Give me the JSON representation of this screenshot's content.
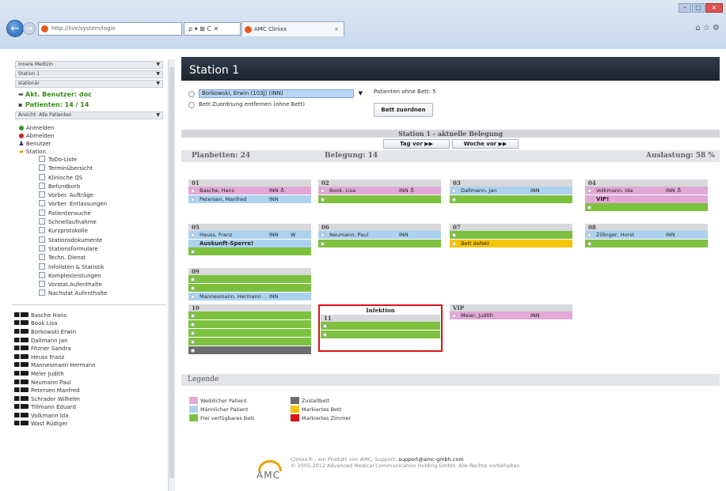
{
  "browser": {
    "url": "http://live/system/login",
    "search_controls": "ρ ▾ ⊠ C ✕",
    "tab_title": "AMC Clinixx",
    "tab_close": "×",
    "back_glyph": "←",
    "forward_glyph": "→",
    "min_glyph": "–",
    "max_glyph": "□",
    "close_glyph": "×",
    "tools_glyphs": "⌂ ☆ ⚙"
  },
  "sidebar": {
    "select_department": "Innere Medizin",
    "select_station": "Station 1",
    "select_type": "stationär",
    "current_user": "Akt. Benutzer: doc",
    "patients_count": "Patienten: 14 / 14",
    "view_select": "Ansicht: Alle Patienten",
    "menu": [
      {
        "label": "Anmelden",
        "icon": "login-icon"
      },
      {
        "label": "Abmelden",
        "icon": "logout-icon"
      },
      {
        "label": "Benutzer",
        "icon": "user-icon"
      },
      {
        "label": "Station",
        "icon": "folder-icon"
      }
    ],
    "submenu": [
      "ToDo-Liste",
      "Terminübersicht",
      "Klinische QS",
      "Befundkorb",
      "Vorber. Aufträge",
      "Vorber. Entlassungen",
      "Patientensuche",
      "Schnellaufnahme",
      "Kurzprotokolle",
      "Stationsdokumente",
      "Stationsformulare",
      "Techn. Dienst",
      "Infolisten & Statistik",
      "Komplexleistungen",
      "Vorstat.Aufenthalte",
      "Nachstat.Aufenthalte"
    ],
    "patients": [
      "Basche Hans",
      "Book Lisa",
      "Borkowski Erwin",
      "Dallmann Jan",
      "Fitzner Sandra",
      "Heuss Franz",
      "Mannesmann Hermann",
      "Meier Judith",
      "Neumann Paul",
      "Petersen Manfred",
      "Schrader Wilhelm",
      "Tillmann Eduard",
      "Volkmann Ida",
      "Wast Rüdiger"
    ]
  },
  "main": {
    "title": "Station 1",
    "patient_select": "Borkowski, Erwin (103J) (INN)",
    "patients_without_bed": "Patienten ohne Bett: 5",
    "remove_assignment": "Bett-Zuordnung entfernen (ohne Bett)",
    "assign_button": "Bett zuordnen",
    "occupancy_title": "Station 1 - aktuelle Belegung",
    "day_forward": "Tag vor ▶▶",
    "week_forward": "Woche vor ▶▶",
    "planned_beds": "Planbetten: 24",
    "occupancy": "Belegung: 14",
    "utilization": "Auslastung: 58 %",
    "rooms": {
      "r01": {
        "name": "01",
        "beds": [
          {
            "name": "Basche, Hans",
            "ward": "INN",
            "sym": "♁"
          },
          {
            "name": "Petersen, Manfred",
            "ward": "INN"
          }
        ]
      },
      "r02": {
        "name": "02",
        "beds": [
          {
            "name": "Book, Lisa",
            "ward": "INN",
            "sym": "♁"
          }
        ]
      },
      "r03": {
        "name": "03",
        "beds": [
          {
            "name": "Dallmann, Jan",
            "ward": "INN"
          }
        ]
      },
      "r04": {
        "name": "04",
        "beds": [
          {
            "name": "Volkmann, Ida",
            "ward": "INN",
            "sym": "♁"
          }
        ],
        "note": "VIP!"
      },
      "r05": {
        "name": "05",
        "beds": [
          {
            "name": "Heuss, Franz",
            "ward": "INN",
            "extra": "W"
          }
        ],
        "note": "Auskunft-Sperre!"
      },
      "r06": {
        "name": "06",
        "beds": [
          {
            "name": "Neumann, Paul",
            "ward": "INN"
          }
        ]
      },
      "r07": {
        "name": "07",
        "marked_bed": "Bett defekt"
      },
      "r08": {
        "name": "08",
        "beds": [
          {
            "name": "Zillinger, Horst",
            "ward": "INN"
          }
        ]
      },
      "r09": {
        "name": "09",
        "beds": [
          {
            "name": "Mannesmann, Hermann",
            "ward": "INN"
          }
        ]
      },
      "r10": {
        "name": "10"
      },
      "r11": {
        "name": "11",
        "label": "Infektion"
      },
      "rvip": {
        "name": "VIP",
        "beds": [
          {
            "name": "Meier, Judith",
            "ward": "INN"
          }
        ]
      }
    },
    "legend_title": "Legende",
    "legend": [
      {
        "label": "Weiblicher Patient",
        "color": "#e2a8d6"
      },
      {
        "label": "Männlicher Patient",
        "color": "#acd2ef"
      },
      {
        "label": "Frei verfügbares Bett",
        "color": "#7dc13f"
      },
      {
        "label": "Zustellbett",
        "color": "#6a6c6f"
      },
      {
        "label": "Markiertes Bett",
        "color": "#f6c400"
      },
      {
        "label": "Markiertes Zimmer",
        "color": "#d81515"
      }
    ],
    "logo_text": "AMC",
    "footer_line1_a": "Clinixx® - ein Produkt von AMC. Support: ",
    "footer_email": "support@amc-gmbh.com",
    "footer_line2": "© 2005-2012 Advanced Medical Communication Holding GmbH. Alle Rechte vorbehalten"
  }
}
